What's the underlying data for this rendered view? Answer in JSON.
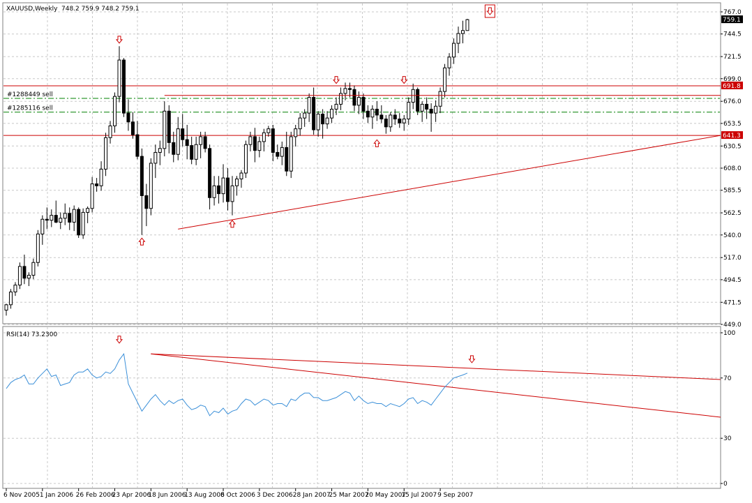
{
  "header": {
    "symbol": "XAUUSD,Weekly",
    "ohlc": "748.2 759.9 748.2 759.1"
  },
  "rsi_label": "RSI(14) 73.2300",
  "colors": {
    "bull": "#ffffff",
    "bear": "#000000",
    "wick": "#000000",
    "rsi_line": "#3a8fd8",
    "trend": "#cc0000",
    "level": "#cc0000",
    "dashdot": "#008000",
    "grid": "#c8c8c8"
  },
  "chart_data": [
    {
      "type": "candlestick",
      "title": "XAUUSD,Weekly",
      "x_tick_labels": [
        "6 Nov 2005",
        "1 Jan 2006",
        "26 Feb 2006",
        "23 Apr 2006",
        "18 Jun 2006",
        "13 Aug 2006",
        "8 Oct 2006",
        "3 Dec 2006",
        "28 Jan 2007",
        "25 Mar 2007",
        "20 May 2007",
        "15 Jul 2007",
        "9 Sep 2007"
      ],
      "x_tick_bar_index": [
        0,
        8,
        16,
        24,
        32,
        40,
        48,
        56,
        64,
        72,
        80,
        88,
        96
      ],
      "y_ticks": [
        767.0,
        744.5,
        721.5,
        699.0,
        676.0,
        653.5,
        630.5,
        608.0,
        585.5,
        562.5,
        540.0,
        517.0,
        494.5,
        471.5,
        449.0
      ],
      "ylim": [
        449.0,
        767.0
      ],
      "current_price_label": "759.1",
      "candles": [
        [
          463.5,
          470,
          458,
          469
        ],
        [
          469,
          485,
          465,
          482
        ],
        [
          482,
          492,
          478,
          489
        ],
        [
          489,
          512,
          485,
          508
        ],
        [
          508,
          520,
          490,
          496
        ],
        [
          496,
          502,
          488,
          499
        ],
        [
          499,
          516,
          495,
          512
        ],
        [
          512,
          545,
          508,
          541
        ],
        [
          541,
          560,
          530,
          556
        ],
        [
          556,
          568,
          546,
          555
        ],
        [
          555,
          566,
          548,
          560
        ],
        [
          560,
          575,
          552,
          553
        ],
        [
          553,
          563,
          546,
          557
        ],
        [
          557,
          572,
          550,
          562
        ],
        [
          562,
          568,
          545,
          553
        ],
        [
          553,
          570,
          544,
          566
        ],
        [
          566,
          568,
          537,
          540
        ],
        [
          540,
          567,
          536,
          563
        ],
        [
          563,
          569,
          552,
          567
        ],
        [
          567,
          599,
          563,
          592
        ],
        [
          592,
          598,
          584,
          590
        ],
        [
          590,
          615,
          585,
          607
        ],
        [
          607,
          644,
          600,
          639
        ],
        [
          639,
          656,
          633,
          651
        ],
        [
          651,
          685,
          644,
          681
        ],
        [
          681,
          732,
          675,
          718
        ],
        [
          718,
          720,
          660,
          664
        ],
        [
          664,
          678,
          646,
          655
        ],
        [
          655,
          665,
          638,
          642
        ],
        [
          642,
          656,
          617,
          620
        ],
        [
          620,
          628,
          540,
          580
        ],
        [
          580,
          592,
          549,
          567
        ],
        [
          567,
          618,
          560,
          613
        ],
        [
          613,
          632,
          598,
          624
        ],
        [
          624,
          636,
          611,
          628
        ],
        [
          628,
          676,
          620,
          666
        ],
        [
          666,
          672,
          623,
          634
        ],
        [
          634,
          645,
          614,
          622
        ],
        [
          622,
          660,
          616,
          648
        ],
        [
          648,
          663,
          630,
          637
        ],
        [
          637,
          652,
          617,
          631
        ],
        [
          631,
          640,
          612,
          617
        ],
        [
          617,
          640,
          611,
          632
        ],
        [
          632,
          645,
          618,
          640
        ],
        [
          640,
          645,
          624,
          628
        ],
        [
          628,
          632,
          566,
          578
        ],
        [
          578,
          600,
          570,
          590
        ],
        [
          590,
          600,
          572,
          582
        ],
        [
          582,
          612,
          573,
          598
        ],
        [
          598,
          608,
          565,
          574
        ],
        [
          574,
          600,
          560,
          590
        ],
        [
          590,
          600,
          580,
          597
        ],
        [
          597,
          606,
          588,
          603
        ],
        [
          603,
          636,
          598,
          632
        ],
        [
          632,
          645,
          625,
          640
        ],
        [
          640,
          649,
          614,
          626
        ],
        [
          626,
          640,
          619,
          635
        ],
        [
          635,
          648,
          625,
          644
        ],
        [
          644,
          651,
          640,
          648
        ],
        [
          648,
          652,
          615,
          624
        ],
        [
          624,
          632,
          617,
          620
        ],
        [
          620,
          635,
          611,
          629
        ],
        [
          629,
          645,
          600,
          605
        ],
        [
          605,
          645,
          598,
          640
        ],
        [
          640,
          652,
          630,
          648
        ],
        [
          648,
          664,
          641,
          659
        ],
        [
          659,
          668,
          650,
          664
        ],
        [
          664,
          684,
          655,
          680
        ],
        [
          680,
          690,
          642,
          647
        ],
        [
          647,
          666,
          640,
          663
        ],
        [
          663,
          668,
          638,
          653
        ],
        [
          653,
          666,
          648,
          659
        ],
        [
          659,
          672,
          654,
          668
        ],
        [
          668,
          680,
          662,
          673
        ],
        [
          673,
          690,
          667,
          684
        ],
        [
          684,
          695,
          677,
          689
        ],
        [
          689,
          695,
          680,
          688
        ],
        [
          688,
          692,
          666,
          672
        ],
        [
          672,
          686,
          663,
          680
        ],
        [
          680,
          684,
          658,
          666
        ],
        [
          666,
          672,
          654,
          660
        ],
        [
          660,
          672,
          648,
          668
        ],
        [
          668,
          676,
          656,
          662
        ],
        [
          662,
          672,
          654,
          658
        ],
        [
          658,
          662,
          643,
          650
        ],
        [
          650,
          665,
          645,
          662
        ],
        [
          662,
          668,
          652,
          658
        ],
        [
          658,
          664,
          649,
          654
        ],
        [
          654,
          662,
          646,
          658
        ],
        [
          658,
          680,
          652,
          675
        ],
        [
          675,
          694,
          668,
          688
        ],
        [
          688,
          690,
          662,
          666
        ],
        [
          666,
          676,
          655,
          673
        ],
        [
          673,
          680,
          658,
          668
        ],
        [
          668,
          674,
          645,
          664
        ],
        [
          664,
          677,
          655,
          671
        ],
        [
          671,
          690,
          664,
          686
        ],
        [
          686,
          714,
          680,
          710
        ],
        [
          710,
          725,
          702,
          721
        ],
        [
          721,
          740,
          714,
          735
        ],
        [
          735,
          752,
          725,
          745
        ],
        [
          745,
          758,
          735,
          748
        ],
        [
          748,
          759.9,
          748.2,
          759.1
        ]
      ],
      "annotation_levels": [
        {
          "price": 691.8,
          "label": "691.8"
        },
        {
          "price": 641.3,
          "label": "641.3"
        }
      ],
      "order_lines": [
        {
          "price": 679.0,
          "label": "#1288449 sell"
        },
        {
          "price": 665.0,
          "label": "#1285116 sell"
        }
      ]
    },
    {
      "type": "line",
      "title": "RSI(14) 73.2300",
      "y_ticks": [
        100,
        70,
        30,
        0
      ],
      "ylim": [
        0,
        100
      ],
      "values": [
        63,
        67,
        69,
        70,
        72,
        66,
        66,
        70,
        73,
        76,
        71,
        72,
        65,
        66,
        67,
        72,
        74,
        74,
        76,
        72,
        70,
        71,
        74,
        73,
        76,
        82,
        86,
        66,
        60,
        54,
        48,
        52,
        56,
        59,
        55,
        52,
        55,
        53,
        55,
        56,
        52,
        49,
        50,
        52,
        51,
        45,
        48,
        47,
        50,
        46,
        48,
        49,
        53,
        56,
        55,
        52,
        54,
        56,
        55,
        52,
        53,
        53,
        51,
        56,
        55,
        58,
        60,
        60,
        57,
        57,
        55,
        55,
        56,
        57,
        59,
        61,
        60,
        55,
        58,
        55,
        53,
        54,
        53,
        53,
        51,
        53,
        52,
        51,
        53,
        56,
        57,
        53,
        55,
        54,
        52,
        56,
        60,
        64,
        67,
        70,
        71,
        72,
        73.23
      ]
    }
  ]
}
